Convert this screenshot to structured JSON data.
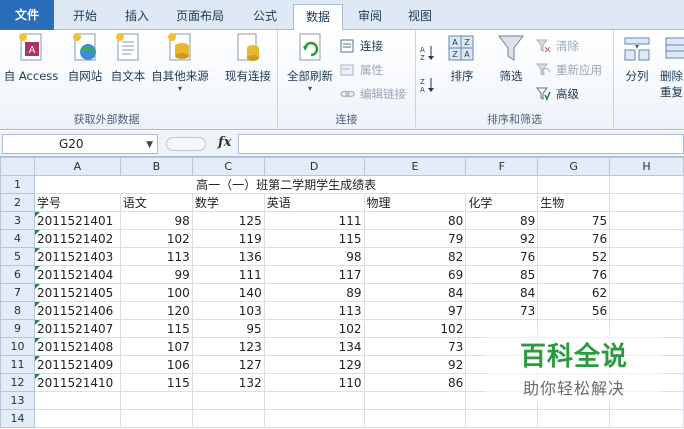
{
  "tabs": [
    "文件",
    "开始",
    "插入",
    "页面布局",
    "公式",
    "数据",
    "审阅",
    "视图"
  ],
  "ribbon": {
    "get_external": {
      "label": "获取外部数据",
      "buttons": [
        "自 Access",
        "自网站",
        "自文本",
        "自其他来源",
        "现有连接"
      ]
    },
    "connections": {
      "label": "连接",
      "refresh_all": "全部刷新",
      "connect": "连接",
      "properties": "属性",
      "edit_links": "编辑链接"
    },
    "sort_filter": {
      "label": "排序和筛选",
      "sort": "排序",
      "filter": "筛选",
      "clear": "清除",
      "reapply": "重新应用",
      "advanced": "高级"
    },
    "tools": {
      "split": "分列",
      "remove": "删除",
      "remove2": "重复"
    }
  },
  "formula_bar": {
    "name_box": "G20",
    "fx": "fx",
    "value": ""
  },
  "sheet": {
    "columns": [
      "A",
      "B",
      "C",
      "D",
      "E",
      "F",
      "G",
      "H"
    ],
    "title": "高一（一）班第二学期学生成绩表",
    "headers": [
      "学号",
      "语文",
      "数学",
      "英语",
      "物理",
      "化学",
      "生物"
    ],
    "rows": [
      [
        "2011521401",
        "98",
        "125",
        "111",
        "80",
        "89",
        "75"
      ],
      [
        "2011521402",
        "102",
        "119",
        "115",
        "79",
        "92",
        "76"
      ],
      [
        "2011521403",
        "113",
        "136",
        "98",
        "82",
        "76",
        "52"
      ],
      [
        "2011521404",
        "99",
        "111",
        "117",
        "69",
        "85",
        "76"
      ],
      [
        "2011521405",
        "100",
        "140",
        "89",
        "84",
        "84",
        "62"
      ],
      [
        "2011521406",
        "120",
        "103",
        "113",
        "97",
        "73",
        "56"
      ],
      [
        "2011521407",
        "115",
        "95",
        "102",
        "102",
        "",
        ""
      ],
      [
        "2011521408",
        "107",
        "123",
        "134",
        "73",
        "",
        ""
      ],
      [
        "2011521409",
        "106",
        "127",
        "129",
        "92",
        "",
        ""
      ],
      [
        "2011521410",
        "115",
        "132",
        "110",
        "86",
        "",
        ""
      ]
    ],
    "row_numbers": [
      "1",
      "2",
      "3",
      "4",
      "5",
      "6",
      "7",
      "8",
      "9",
      "10",
      "11",
      "12",
      "13",
      "14"
    ]
  },
  "watermark": {
    "title": "百科全说",
    "subtitle": "助你轻松解决"
  },
  "colors": {
    "file_tab": "#2a6db8",
    "ribbon_border": "#a9bcd6",
    "watermark_green": "#2a9a3e"
  }
}
